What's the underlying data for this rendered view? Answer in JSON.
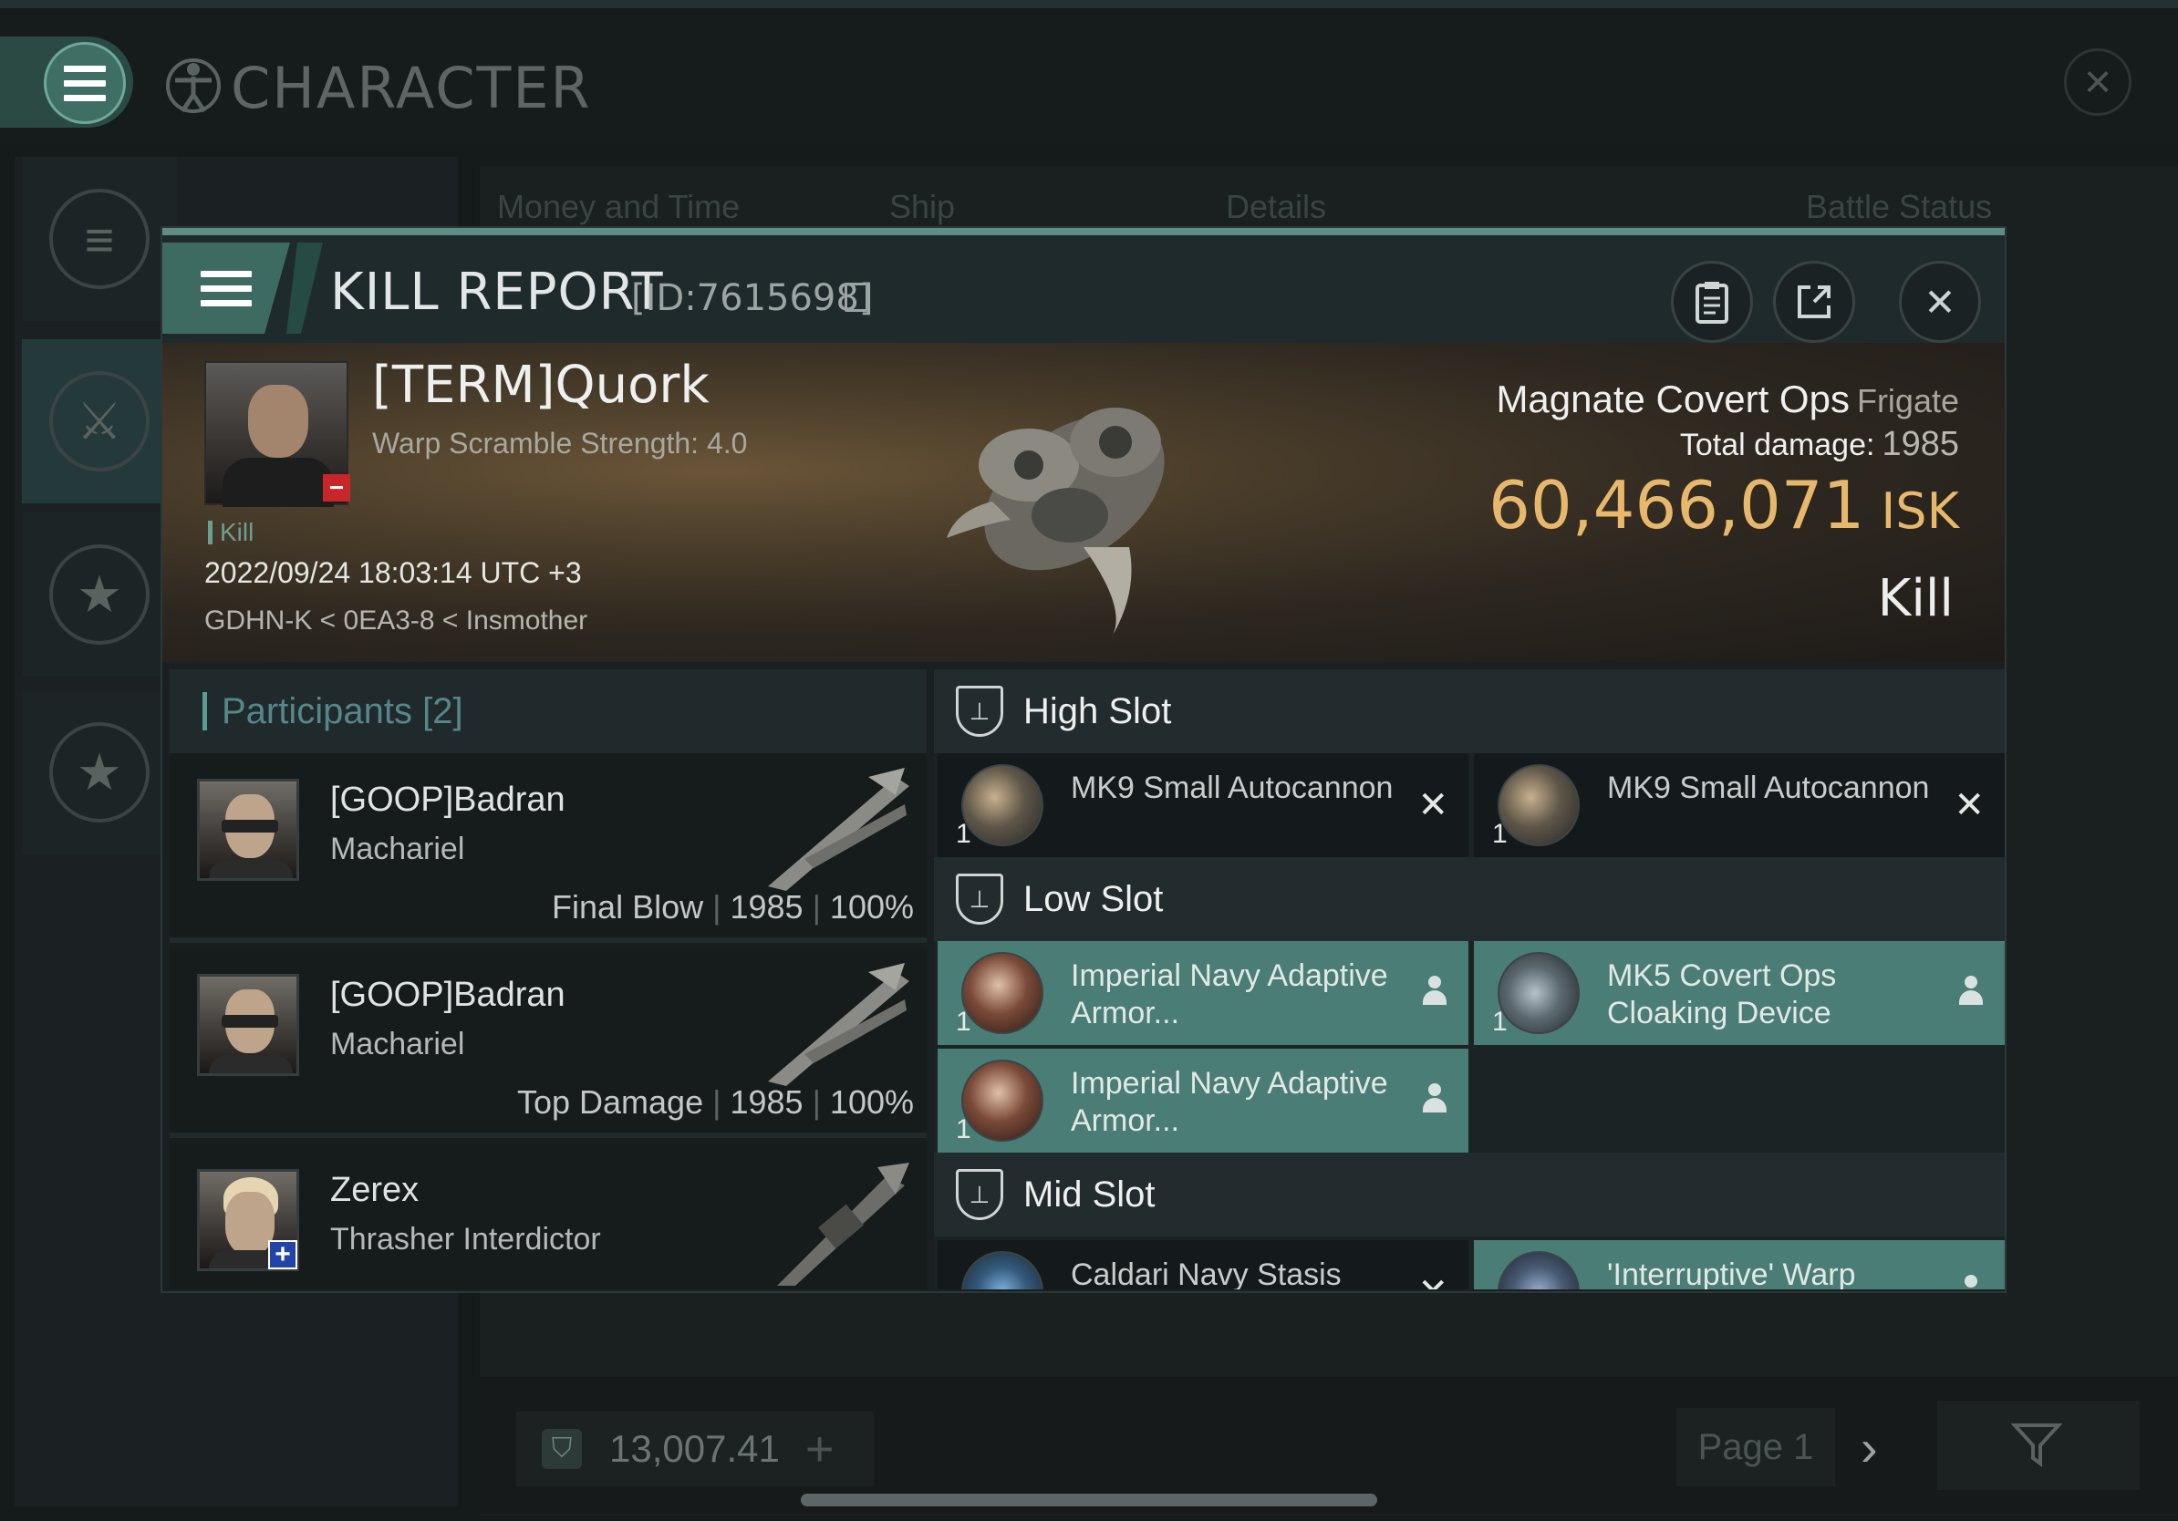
{
  "window": {
    "title": "CHARACTER",
    "columns": [
      "Money and Time",
      "Ship",
      "Details",
      "Battle Status"
    ]
  },
  "footer": {
    "wallet_value": "13,007.41",
    "page_label": "Page 1"
  },
  "dialog": {
    "title": "KILL REPORT",
    "id_label": "[ID:7615698]"
  },
  "victim": {
    "name": "[TERM]Quork",
    "sub": "Warp Scramble Strength: 4.0",
    "tag": "Kill",
    "datetime": "2022/09/24 18:03:14 UTC +3",
    "location": "GDHN-K < 0EA3-8 < Insmother"
  },
  "summary": {
    "ship_name": "Magnate Covert Ops",
    "ship_class": "Frigate",
    "total_damage_label": "Total damage:",
    "total_damage": "1985",
    "isk_value": "60,466,071",
    "isk_unit": "ISK",
    "result": "Kill"
  },
  "participants": {
    "header": "Participants [2]",
    "rows": [
      {
        "name": "[GOOP]Badran",
        "ship": "Machariel",
        "role": "Final Blow",
        "damage": "1985",
        "percent": "100%"
      },
      {
        "name": "[GOOP]Badran",
        "ship": "Machariel",
        "role": "Top Damage",
        "damage": "1985",
        "percent": "100%"
      },
      {
        "name": "Zerex",
        "ship": "Thrasher Interdictor"
      }
    ]
  },
  "slots": {
    "high": {
      "title": "High Slot",
      "items": [
        {
          "qty": "1",
          "name": "MK9 Small Autocannon",
          "status": "destroyed"
        },
        {
          "qty": "1",
          "name": "MK9 Small Autocannon",
          "status": "destroyed"
        }
      ]
    },
    "low": {
      "title": "Low Slot",
      "items": [
        {
          "qty": "1",
          "name": "Imperial Navy Adaptive Armor...",
          "status": "dropped"
        },
        {
          "qty": "1",
          "name": "MK5 Covert Ops Cloaking Device",
          "status": "dropped"
        },
        {
          "qty": "1",
          "name": "Imperial Navy Adaptive Armor...",
          "status": "dropped"
        }
      ]
    },
    "mid": {
      "title": "Mid Slot",
      "items": [
        {
          "name": "Caldari Navy Stasis",
          "status": "destroyed"
        },
        {
          "name": "'Interruptive' Warp",
          "status": "dropped"
        }
      ]
    }
  },
  "colors": {
    "accent_teal": "#5f8d85",
    "fitted_item_bg": "#4a7d76",
    "isk_gold": "#e7b86c",
    "victim_badge_red": "#c8262a"
  }
}
